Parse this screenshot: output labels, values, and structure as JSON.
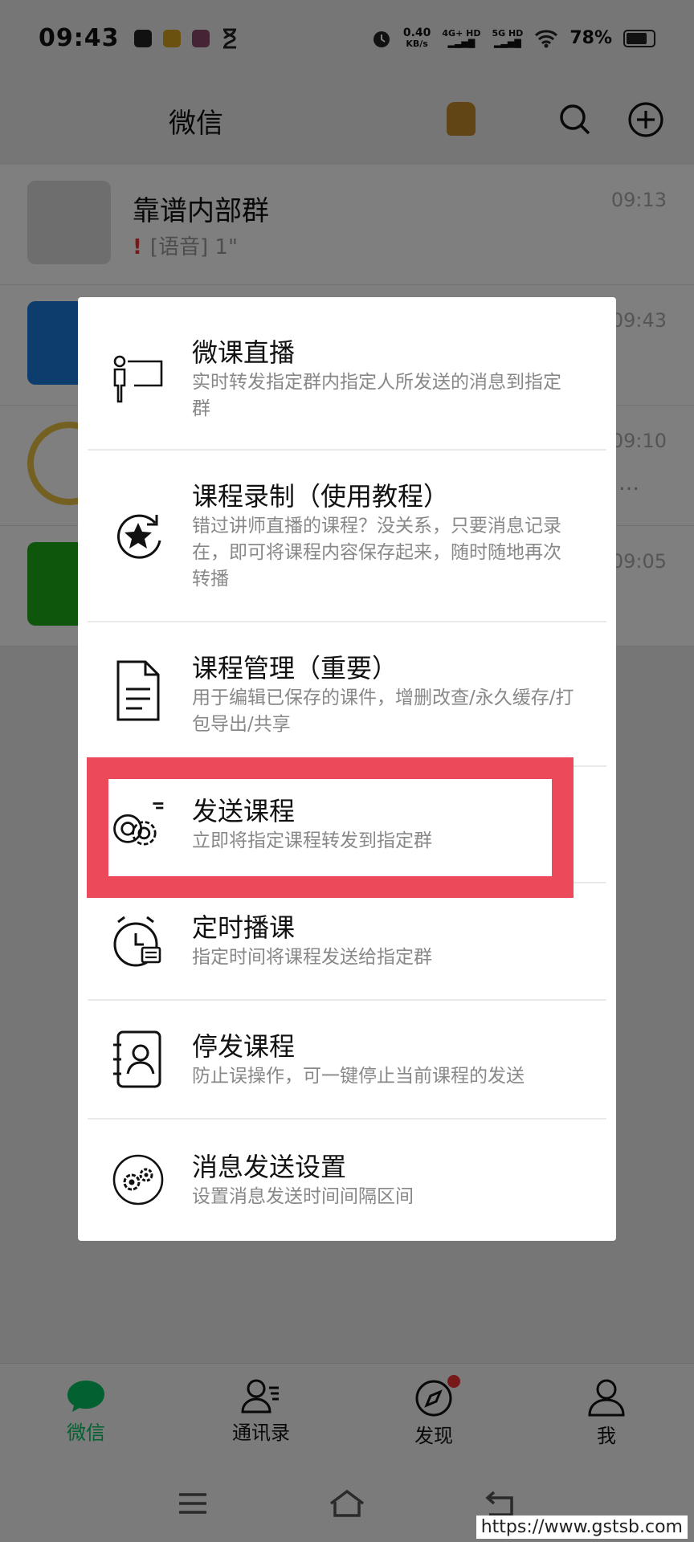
{
  "status_bar": {
    "time": "09:43",
    "speed_value": "0.40",
    "speed_unit": "KB/s",
    "net1": "4G+ HD",
    "net2": "5G HD",
    "battery": "78%",
    "battery_level": 0.78
  },
  "header": {
    "title": "微信"
  },
  "chats": [
    {
      "name": "靠谱内部群",
      "message": "[语音] 1\"",
      "time": "09:13",
      "unread_voice": true,
      "avatar_color": "#dcdcdc"
    },
    {
      "name": "",
      "message": "",
      "time": "09:43",
      "avatar_color": "#1a7ad9"
    },
    {
      "name": "",
      "message": "…",
      "time": "09:10",
      "avatar_color": "#ffffff"
    },
    {
      "name": "",
      "message": "",
      "time": "09:05",
      "avatar_color": "#1aad19"
    }
  ],
  "menu": {
    "items": [
      {
        "title": "微课直播",
        "desc": "实时转发指定群内指定人所发送的消息到指定群",
        "icon": "presenter-icon"
      },
      {
        "title": "课程录制（使用教程）",
        "desc": "错过讲师直播的课程？没关系，只要消息记录在，即可将课程内容保存起来，随时随地再次转播",
        "icon": "star-record-icon"
      },
      {
        "title": "课程管理（重要）",
        "desc": "用于编辑已保存的课件，增删改查/永久缓存/打包导出/共享",
        "icon": "document-icon"
      },
      {
        "title": "发送课程",
        "desc": "立即将指定课程转发到指定群",
        "icon": "send-gears-icon"
      },
      {
        "title": "定时播课",
        "desc": "指定时间将课程发送给指定群",
        "icon": "alarm-clock-icon"
      },
      {
        "title": "停发课程",
        "desc": "防止误操作，可一键停止当前课程的发送",
        "icon": "contact-card-icon"
      },
      {
        "title": "消息发送设置",
        "desc": "设置消息发送时间间隔区间",
        "icon": "settings-gears-icon"
      }
    ]
  },
  "tabs": [
    {
      "label": "微信",
      "icon": "chat-bubble-icon",
      "active": true
    },
    {
      "label": "通讯录",
      "icon": "contacts-icon",
      "active": false
    },
    {
      "label": "发现",
      "icon": "compass-icon",
      "active": false,
      "badge": true
    },
    {
      "label": "我",
      "icon": "person-icon",
      "active": false
    }
  ],
  "watermark": "https://www.gstsb.com",
  "colors": {
    "accent": "#07c160",
    "highlight": "#ec4a5a",
    "badge": "#e33333"
  }
}
